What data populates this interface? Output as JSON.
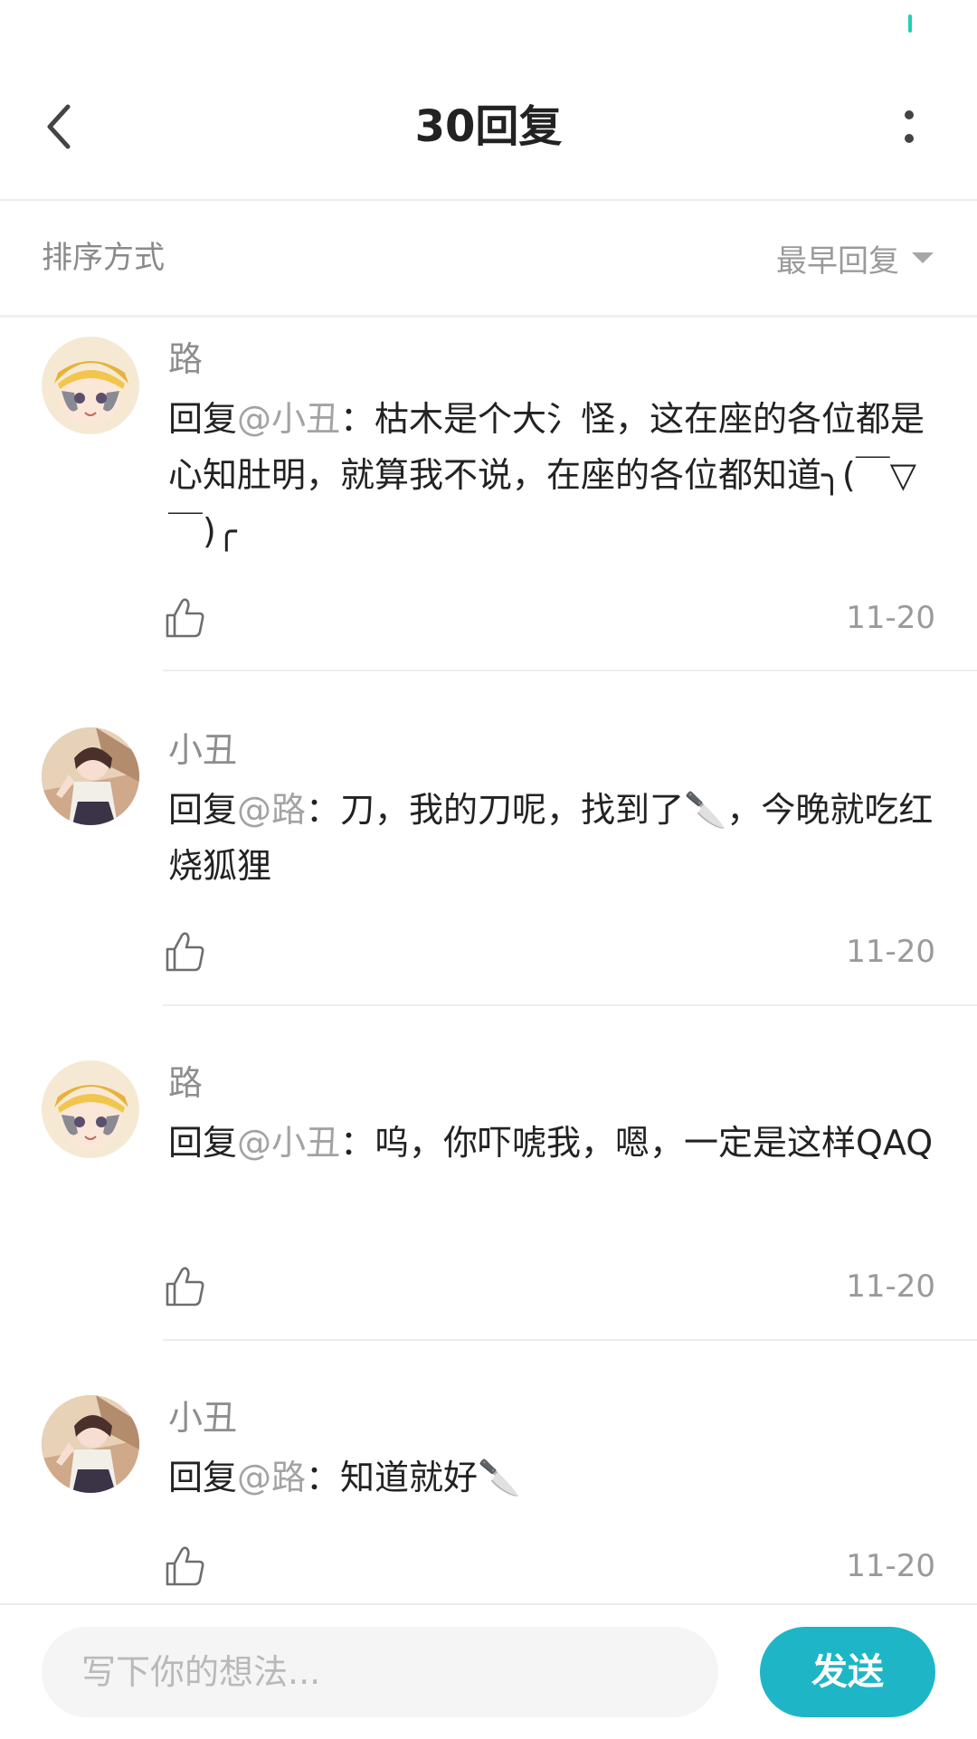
{
  "header": {
    "title": "30回复",
    "back_icon": "chevron-left-icon",
    "more_icon": "more-vertical-icon"
  },
  "sort": {
    "label": "排序方式",
    "selected": "最早回复"
  },
  "replies": [
    {
      "author": "路",
      "prefix": "回复",
      "mention": "@小丑",
      "text": "：枯木是个大氵怪，这在座的各位都是心知肚明，就算我不说，在座的各位都知道╮(￣▽￣)╭",
      "date": "11-20"
    },
    {
      "author": "小丑",
      "prefix": "回复",
      "mention": "@路",
      "text": "：刀，我的刀呢，找到了🔪，今晚就吃红烧狐狸",
      "date": "11-20"
    },
    {
      "author": "路",
      "prefix": "回复",
      "mention": "@小丑",
      "text": "：呜，你吓唬我，嗯，一定是这样QAQ",
      "date": "11-20"
    },
    {
      "author": "小丑",
      "prefix": "回复",
      "mention": "@路",
      "text": "：知道就好🔪",
      "date": "11-20"
    }
  ],
  "composer": {
    "placeholder": "写下你的想法...",
    "send_label": "发送"
  },
  "colors": {
    "accent": "#1eb6c6",
    "status": "#1fd1b0",
    "mention": "#a3a3a3"
  }
}
